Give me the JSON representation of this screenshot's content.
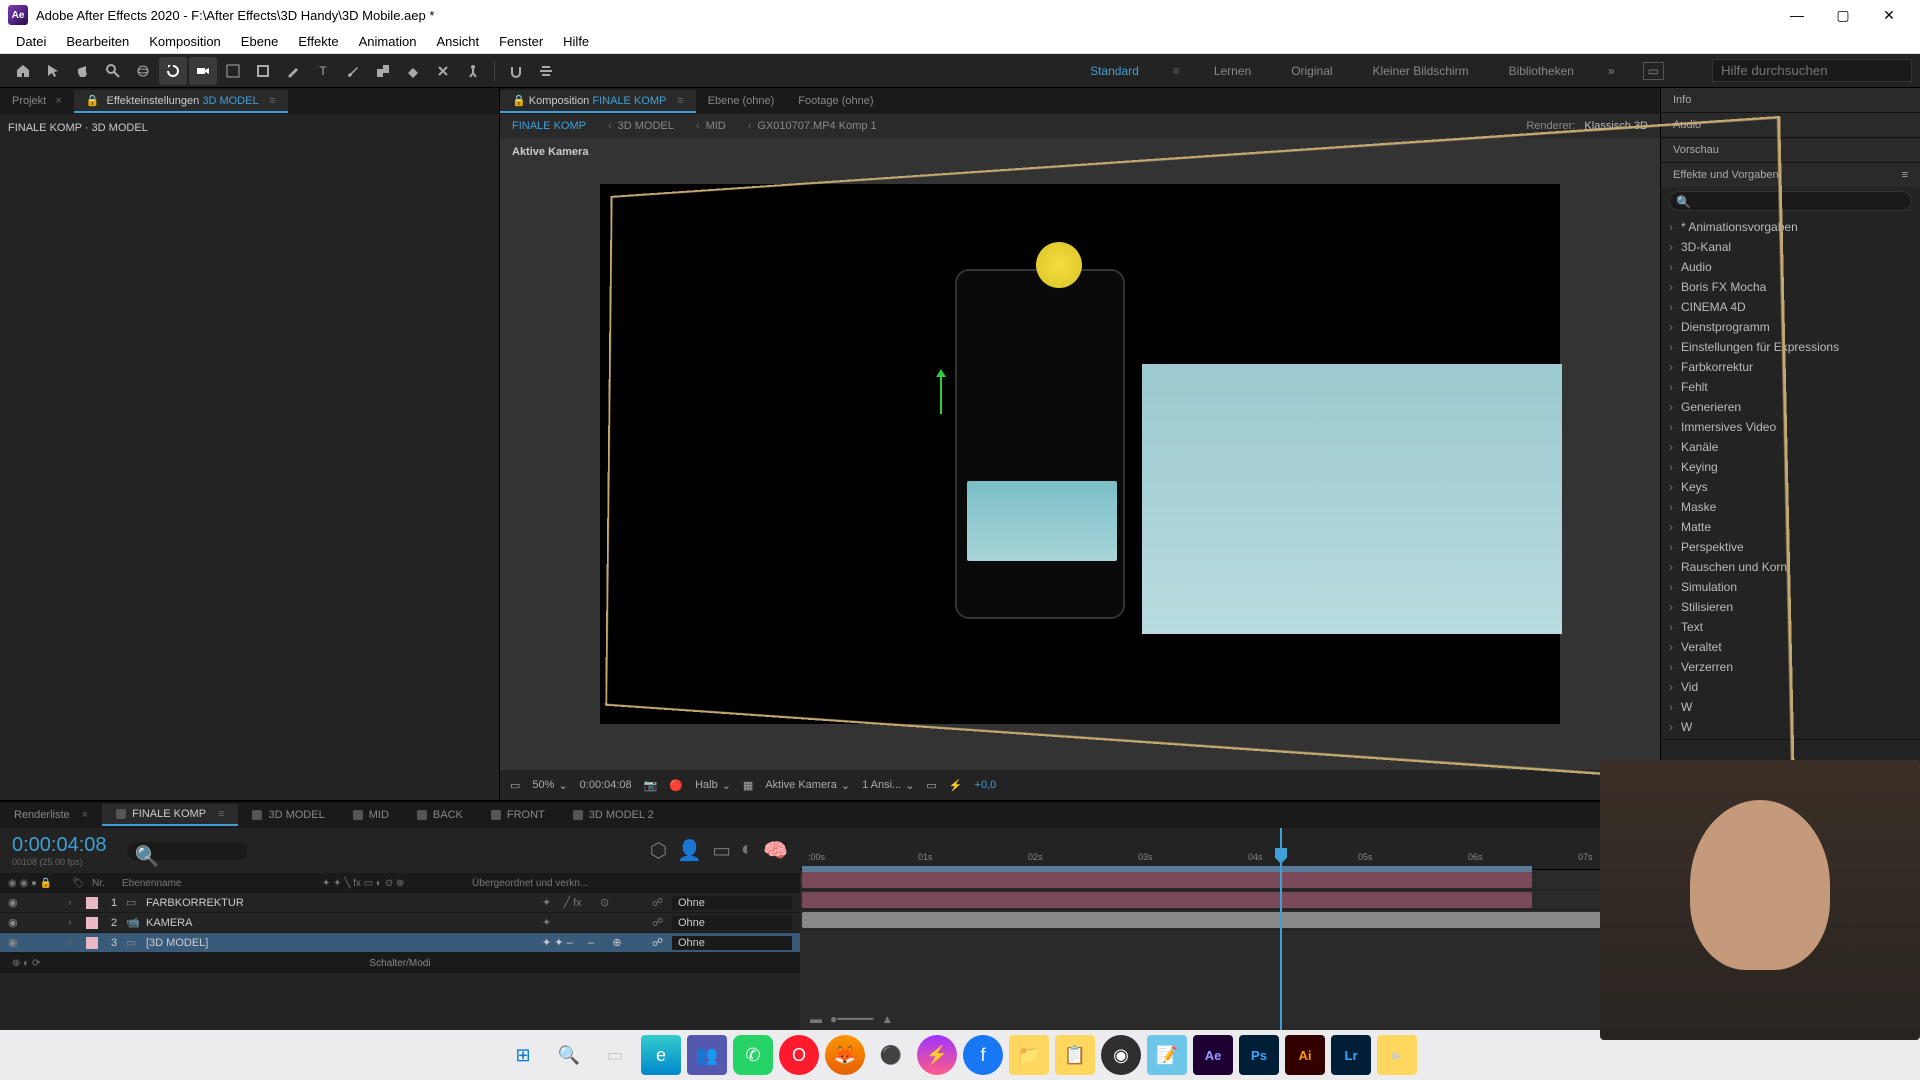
{
  "titlebar": {
    "app_icon_text": "Ae",
    "title": "Adobe After Effects 2020 - F:\\After Effects\\3D Handy\\3D Mobile.aep *"
  },
  "menu": [
    "Datei",
    "Bearbeiten",
    "Komposition",
    "Ebene",
    "Effekte",
    "Animation",
    "Ansicht",
    "Fenster",
    "Hilfe"
  ],
  "workspaces": {
    "items": [
      "Standard",
      "Lernen",
      "Original",
      "Kleiner Bildschirm",
      "Bibliotheken"
    ],
    "active": "Standard",
    "search_placeholder": "Hilfe durchsuchen"
  },
  "left_panel": {
    "tab1": "Projekt",
    "tab2_prefix": "Effekteinstellungen",
    "tab2_comp": "3D MODEL",
    "path": "FINALE KOMP · 3D MODEL"
  },
  "viewer": {
    "tab_komposition_prefix": "Komposition",
    "tab_komposition_name": "FINALE KOMP",
    "tab_ebene": "Ebene (ohne)",
    "tab_footage": "Footage (ohne)",
    "breadcrumb": [
      "FINALE KOMP",
      "3D MODEL",
      "MID",
      "GX010707.MP4 Komp 1"
    ],
    "renderer_label": "Renderer:",
    "renderer_value": "Klassisch 3D",
    "camera_label": "Aktive Kamera",
    "controls": {
      "zoom": "50%",
      "timecode": "0:00:04:08",
      "resolution": "Halb",
      "camera": "Aktive Kamera",
      "views": "1 Ansi...",
      "exposure": "+0,0"
    }
  },
  "right_panel": {
    "sections": [
      "Info",
      "Audio",
      "Vorschau",
      "Effekte und Vorgaben"
    ],
    "effects": [
      "* Animationsvorgaben",
      "3D-Kanal",
      "Audio",
      "Boris FX Mocha",
      "CINEMA 4D",
      "Dienstprogramm",
      "Einstellungen für Expressions",
      "Farbkorrektur",
      "Fehlt",
      "Generieren",
      "Immersives Video",
      "Kanäle",
      "Keying",
      "Keys",
      "Maske",
      "Matte",
      "Perspektive",
      "Rauschen und Korn",
      "Simulation",
      "Stilisieren",
      "Text",
      "Veraltet",
      "Verzerren",
      "Vid",
      "W",
      "W"
    ]
  },
  "timeline": {
    "tabs": [
      "Renderliste",
      "FINALE KOMP",
      "3D MODEL",
      "MID",
      "BACK",
      "FRONT",
      "3D MODEL 2"
    ],
    "active_tab": "FINALE KOMP",
    "timecode": "0:00:04:08",
    "fps_label": "00108 (25.00 fps)",
    "header_cols": {
      "nr": "Nr.",
      "name": "Ebenenname",
      "parent": "Übergeordnet und verkn..."
    },
    "layers": [
      {
        "num": "1",
        "name": "FARBKORREKTUR",
        "color": "#e8b8c4",
        "parent": "Ohne"
      },
      {
        "num": "2",
        "name": "KAMERA",
        "color": "#e8b8c4",
        "parent": "Ohne"
      },
      {
        "num": "3",
        "name": "[3D MODEL]",
        "color": "#e8b8c4",
        "parent": "Ohne"
      }
    ],
    "ticks": [
      ":00s",
      "01s",
      "02s",
      "03s",
      "04s",
      "05s",
      "06s",
      "07s"
    ],
    "footer": "Schalter/Modi"
  },
  "taskbar": {
    "icons": [
      "windows",
      "search",
      "tasks",
      "edge",
      "teams",
      "whatsapp",
      "opera",
      "firefox",
      "emby",
      "messenger",
      "facebook",
      "explorer",
      "notes",
      "obs",
      "notepad",
      "ae",
      "ps",
      "ai",
      "lr",
      "folder"
    ]
  }
}
